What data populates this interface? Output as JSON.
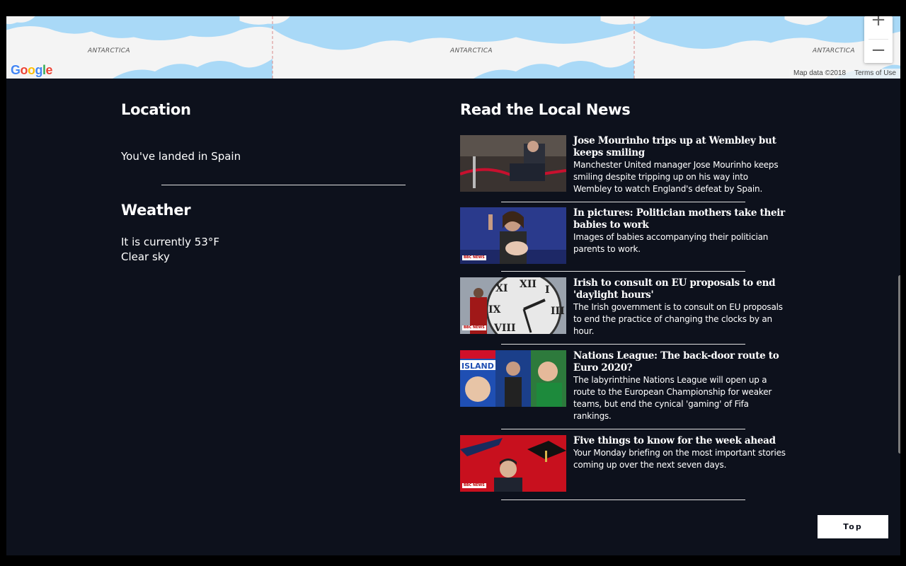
{
  "map": {
    "labels": [
      "ANTARCTICA",
      "ANTARCTICA",
      "ANTARCTICA"
    ],
    "logo": "Google",
    "zoom_in": "+",
    "zoom_out": "−",
    "footer": {
      "data": "Map data ©2018",
      "terms": "Terms of Use"
    }
  },
  "location": {
    "title": "Location",
    "text": "You've landed in Spain"
  },
  "weather": {
    "title": "Weather",
    "temperature_text": "It is currently 53°F",
    "condition": "Clear sky"
  },
  "news": {
    "title": "Read the Local News",
    "badge": "BBC NEWS",
    "items": [
      {
        "headline": "Jose Mourinho trips up at Wembley but keeps smiling",
        "summary": "Manchester United manager Jose Mourinho keeps smiling despite tripping up on his way into Wembley to watch England's defeat by Spain."
      },
      {
        "headline": "In pictures: Politician mothers take their babies to work",
        "summary": "Images of babies accompanying their politician parents to work."
      },
      {
        "headline": "Irish to consult on EU proposals to end 'daylight hours'",
        "summary": "The Irish government is to consult on EU proposals to end the practice of changing the clocks by an hour."
      },
      {
        "headline": "Nations League: The back-door route to Euro 2020?",
        "summary": "The labyrinthine Nations League will open up a route to the European Championship for weaker teams, but end the cynical 'gaming' of Fifa rankings."
      },
      {
        "headline": "Five things to know for the week ahead",
        "summary": "Your Monday briefing on the most important stories coming up over the next seven days."
      }
    ]
  },
  "top_button": "Top",
  "colors": {
    "page_background": "#0d111c",
    "map_water": "#a9d9f7",
    "text": "#ffffff"
  }
}
